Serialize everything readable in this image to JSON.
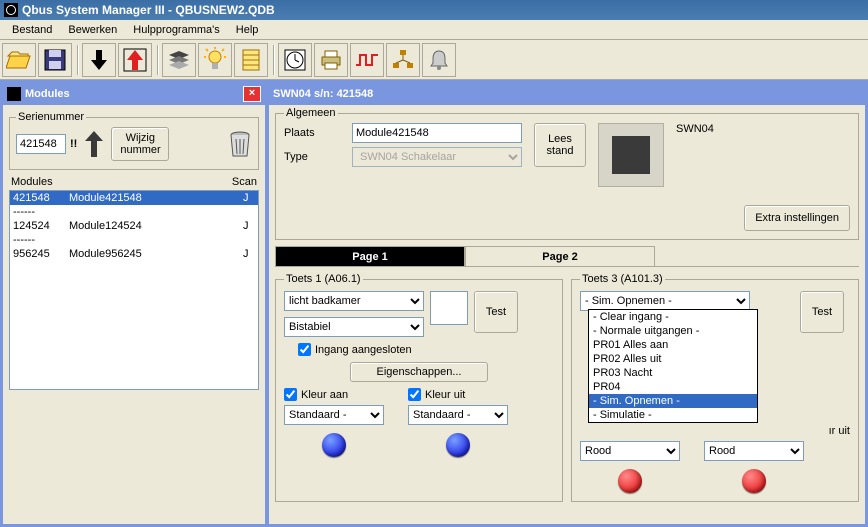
{
  "window": {
    "title": "Qbus System Manager III - QBUSNEW2.QDB"
  },
  "menu": {
    "bestand": "Bestand",
    "bewerken": "Bewerken",
    "hulp": "Hulpprogramma's",
    "help": "Help"
  },
  "modules_panel": {
    "title": "Modules",
    "serienummer_legend": "Serienummer",
    "serienummer_value": "421548",
    "excl": "!!",
    "wijzig_btn": "Wijzig nummer",
    "header_modules": "Modules",
    "header_scan": "Scan",
    "rows": [
      {
        "sn": "421548",
        "name": "Module421548",
        "scan": "J",
        "selected": true
      },
      {
        "sep": true
      },
      {
        "sn": "124524",
        "name": "Module124524",
        "scan": "J"
      },
      {
        "sep": true
      },
      {
        "sn": "956245",
        "name": "Module956245",
        "scan": "J"
      }
    ]
  },
  "right": {
    "title": "SWN04 s/n: 421548",
    "algemeen_legend": "Algemeen",
    "plaats_label": "Plaats",
    "plaats_value": "Module421548",
    "type_label": "Type",
    "type_value": "SWN04 Schakelaar",
    "lees_stand": "Lees stand",
    "mod_name": "SWN04",
    "extra": "Extra instellingen",
    "tab1": "Page 1",
    "tab2": "Page 2",
    "toets1": {
      "legend": "Toets 1 (A06.1)",
      "sel1": "licht badkamer",
      "sel2": "Bistabiel",
      "ingang": "Ingang aangesloten",
      "eig": "Eigenschappen...",
      "kleur_aan": "Kleur aan",
      "kleur_uit": "Kleur uit",
      "std1": "Standaard -",
      "std2": "Standaard -",
      "test": "Test"
    },
    "toets3": {
      "legend": "Toets 3 (A101.3)",
      "display": "- Sim. Opnemen -",
      "options": [
        "- Clear ingang -",
        "- Normale uitgangen -",
        "PR01 Alles aan",
        "PR02 Alles uit",
        "PR03 Nacht",
        "PR04",
        "- Sim. Opnemen -",
        "- Simulatie -"
      ],
      "selected_index": 6,
      "kleur_uit_partial": "ır uit",
      "rood1": "Rood",
      "rood2": "Rood",
      "test": "Test"
    }
  }
}
